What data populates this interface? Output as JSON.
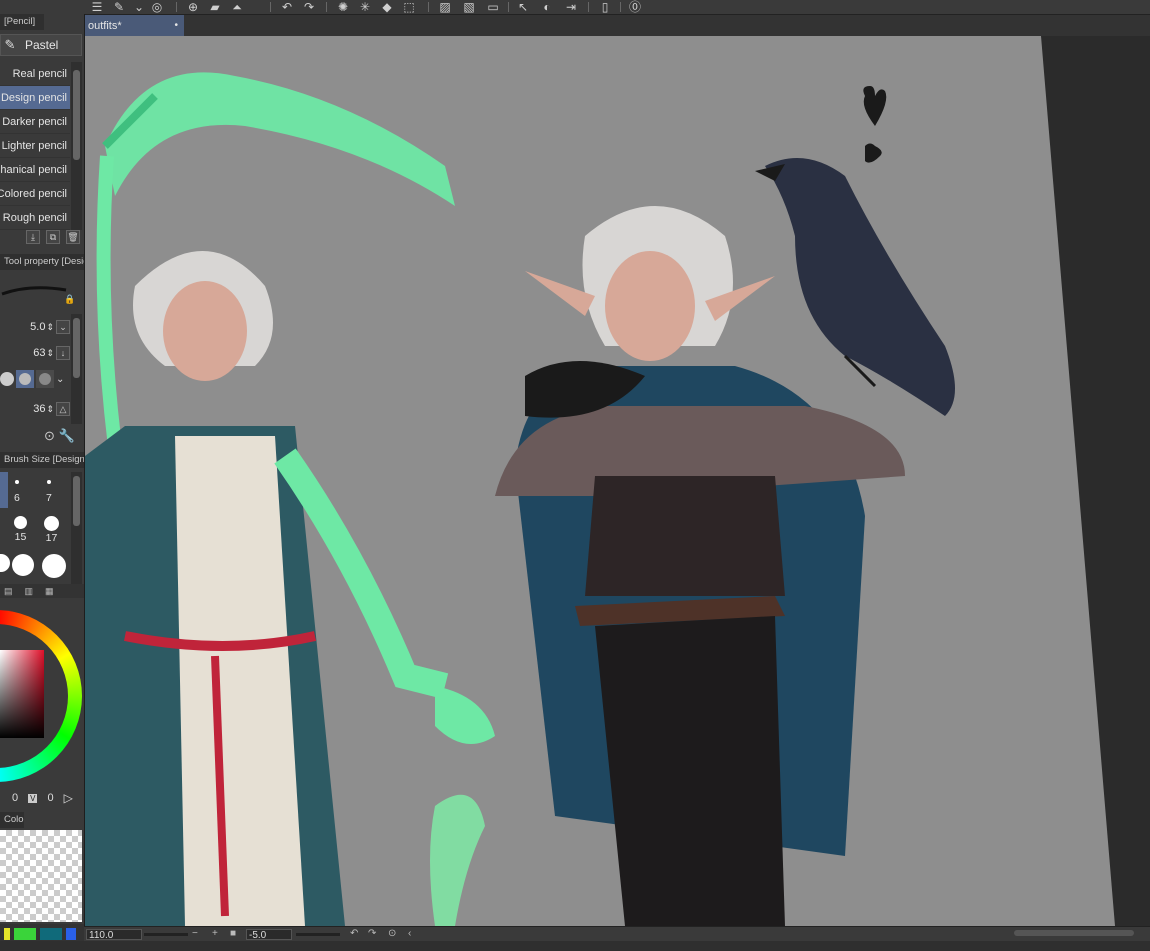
{
  "document": {
    "tab_label": "outfits*",
    "tab_close": "•"
  },
  "tool_panel": {
    "tool_tab": "[Pencil]",
    "active_group": "Pastel",
    "brushes": [
      {
        "label": "Real pencil",
        "selected": false
      },
      {
        "label": "Design pencil",
        "selected": true
      },
      {
        "label": "Darker pencil",
        "selected": false
      },
      {
        "label": "Lighter pencil",
        "selected": false
      },
      {
        "label": "Mechanical pencil",
        "selected": false
      },
      {
        "label": "Colored pencil",
        "selected": false
      },
      {
        "label": "Rough pencil",
        "selected": false
      }
    ]
  },
  "property_panel": {
    "title": "Tool property [Design pencil]",
    "brush_size": "5.0",
    "opacity": "63",
    "hardness_value": "36"
  },
  "brush_size_panel": {
    "title": "Brush Size [Design pencil]",
    "sizes": [
      "6",
      "7",
      "15",
      "17"
    ]
  },
  "color_panel": {
    "v1": "0",
    "v2": "V",
    "v3": "0"
  },
  "mixing_panel": {
    "title": "Color Mixing"
  },
  "statusbar": {
    "zoom": "110.0",
    "rotation": "-5.0"
  },
  "colors": {
    "accent": "#556a92",
    "canvas": "#8e8e8e"
  }
}
